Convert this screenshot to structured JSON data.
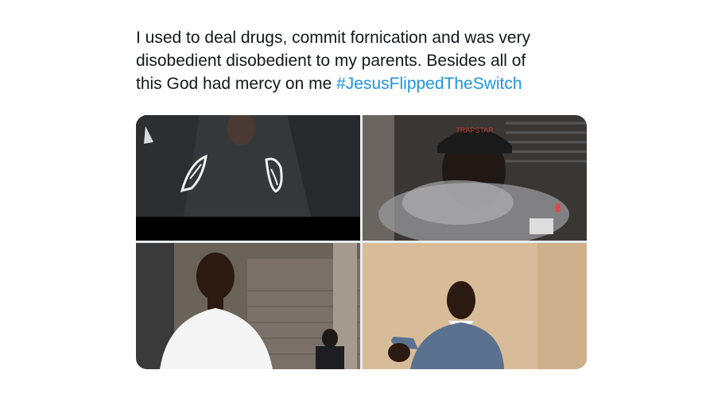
{
  "tweet": {
    "text_line1": "I used to deal drugs, commit fornication and was very",
    "text_line2": "disobedient disobedient to my parents. Besides all of",
    "text_line3_prefix": "this God had mercy on me ",
    "hashtag": "#JesusFlippedTheSwitch"
  },
  "media": {
    "photos": [
      {
        "label": "photo-sneakers"
      },
      {
        "label": "photo-smoke"
      },
      {
        "label": "photo-street"
      },
      {
        "label": "photo-pointing"
      }
    ],
    "cap_text": "TRAPSTAR"
  }
}
